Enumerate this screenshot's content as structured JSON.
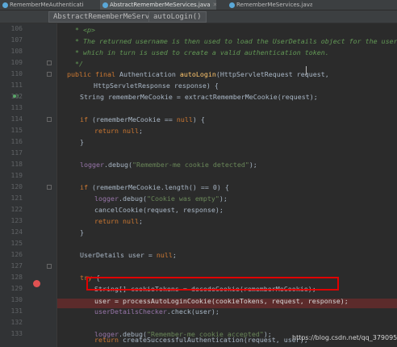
{
  "tabs": [
    {
      "label": "RememberMeAuthenticationFilter.java",
      "active": false
    },
    {
      "label": "AbstractRememberMeServices.java",
      "active": true
    },
    {
      "label": "RememberMeServices.java",
      "active": false
    }
  ],
  "breadcrumb": [
    "AbstractRememberMeServices",
    "autoLogin()"
  ],
  "line_numbers": [
    "106",
    "107",
    "108",
    "109",
    "110",
    "111",
    "112",
    "113",
    "114",
    "115",
    "116",
    "117",
    "118",
    "119",
    "120",
    "121",
    "122",
    "123",
    "124",
    "125",
    "126",
    "127",
    "128",
    "129",
    "130",
    "131",
    "132",
    "133"
  ],
  "code": {
    "l106": "* <p>",
    "l107": "* The returned username is then used to load the UserDetails object for the user,",
    "l108": "* which in turn is used to create a valid authentication token.",
    "l109": "*/",
    "l110a": "public final",
    "l110b": " Authentication ",
    "l110c": "autoLogin",
    "l110d": "(HttpServletRequest request,",
    "l111": "HttpServletResponse response) {",
    "l112": "String rememberMeCookie = extractRememberMeCookie(request);",
    "l114a": "if",
    "l114b": " (rememberMeCookie == ",
    "l114c": "null",
    "l114d": ") {",
    "l115a": "return null",
    "l115b": ";",
    "l118a": "logger",
    "l118b": ".debug(",
    "l118c": "\"Remember-me cookie detected\"",
    "l118d": ");",
    "l120a": "if",
    "l120b": " (rememberMeCookie.length() == 0) {",
    "l121a": "logger",
    "l121b": ".debug(",
    "l121c": "\"Cookie was empty\"",
    "l121d": ");",
    "l122": "cancelCookie(request, response);",
    "l123a": "return null",
    "l123b": ";",
    "l126a": "UserDetails user = ",
    "l126b": "null",
    "l126c": ";",
    "l128a": "try",
    "l128b": " {",
    "l129": "String[] cookieTokens = decodeCookie(rememberMeCookie);",
    "l130": "user = processAutoLoginCookie(cookieTokens, request, response);",
    "l131a": "userDetailsChecker",
    "l131b": ".check(user);",
    "l133a": "logger",
    "l133b": ".debug(",
    "l133c": "\"Remember-me cookie accepted\"",
    "l133d": ");",
    "l135a": "return",
    "l135b": " createSuccessfulAuthentication(request, user);",
    "l116": "}",
    "l124": "}"
  },
  "watermark": "https://blog.csdn.net/qq_37909508",
  "colors": {
    "keyword": "#cc7832",
    "string": "#6a8759",
    "comment": "#629755",
    "method": "#ffc66d",
    "field": "#9876aa",
    "breakpoint": "#e05252",
    "highlight_box": "#e00000"
  }
}
